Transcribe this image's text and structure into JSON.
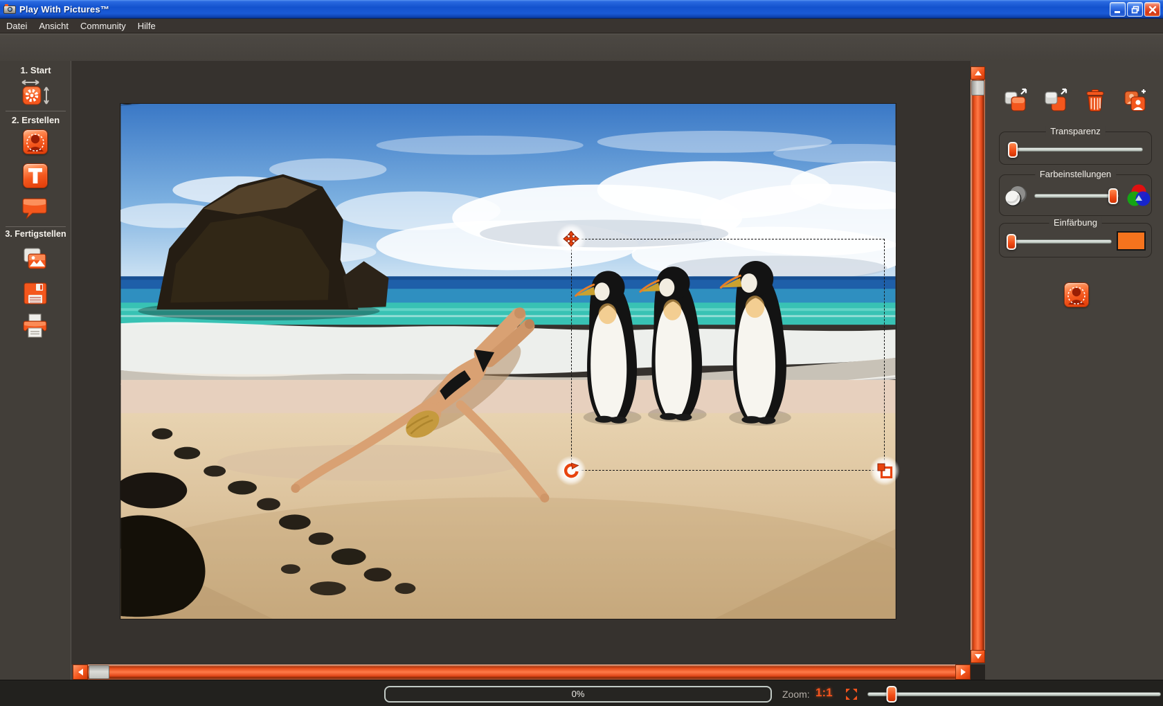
{
  "colors": {
    "accent": "#f14b1d",
    "titlebar_blue": "#1352ce",
    "panel_bg": "#45413c",
    "swatch": "#f5731d",
    "slider_track": "#ccd4ce"
  },
  "window": {
    "title": "Play With Pictures™",
    "controls": [
      {
        "name": "minimize"
      },
      {
        "name": "restore"
      },
      {
        "name": "close"
      }
    ]
  },
  "menu": {
    "items": [
      {
        "label": "Datei"
      },
      {
        "label": "Ansicht"
      },
      {
        "label": "Community"
      },
      {
        "label": "Hilfe"
      }
    ]
  },
  "sidebar": {
    "sections": [
      {
        "label": "1. Start",
        "tools": [
          {
            "name": "canvas-size"
          }
        ]
      },
      {
        "label": "2. Erstellen",
        "tools": [
          {
            "name": "cutout-person"
          },
          {
            "name": "text"
          },
          {
            "name": "speech-bubble"
          }
        ]
      },
      {
        "label": "3. Fertigstellen",
        "tools": [
          {
            "name": "export-image"
          },
          {
            "name": "save"
          },
          {
            "name": "print"
          }
        ]
      }
    ]
  },
  "canvas": {
    "selected_object": "penguins-cutout",
    "selection_handles": [
      {
        "name": "move"
      },
      {
        "name": "rotate"
      },
      {
        "name": "scale"
      }
    ]
  },
  "right_panel": {
    "toolbar": [
      {
        "name": "bring-to-front"
      },
      {
        "name": "send-to-back"
      },
      {
        "name": "delete"
      },
      {
        "name": "add-cutout"
      }
    ],
    "groups": [
      {
        "label": "Transparenz",
        "slider_pct": 3
      },
      {
        "label": "Farbeinstellungen",
        "slider_pct": 94
      },
      {
        "label": "Einfärbung",
        "slider_pct": 3,
        "swatch_color": "#f5731d"
      }
    ],
    "extra_button": {
      "name": "cutout-person"
    }
  },
  "statusbar": {
    "progress_label": "0%",
    "zoom_label": "Zoom:",
    "zoom_actual_label": "1:1",
    "zoom_slider_pct": 8
  }
}
